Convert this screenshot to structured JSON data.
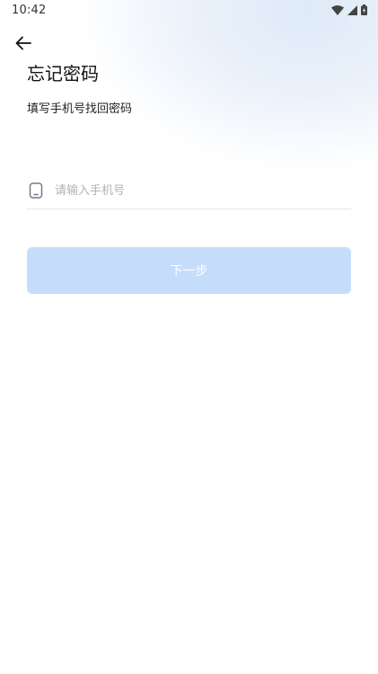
{
  "status_bar": {
    "time": "10:42",
    "icons": [
      "wifi-icon",
      "signal-icon",
      "battery-icon"
    ]
  },
  "header": {
    "back_icon": "arrow-left-icon",
    "title": "忘记密码",
    "subtitle": "填写手机号找回密码"
  },
  "form": {
    "phone": {
      "icon": "phone-icon",
      "value": "",
      "placeholder": "请输入手机号"
    },
    "next_label": "下一步"
  },
  "colors": {
    "primary_disabled": "#c6dcfb",
    "text_primary": "#111111",
    "placeholder": "#b3b3b3",
    "divider": "#e6e6e6"
  }
}
